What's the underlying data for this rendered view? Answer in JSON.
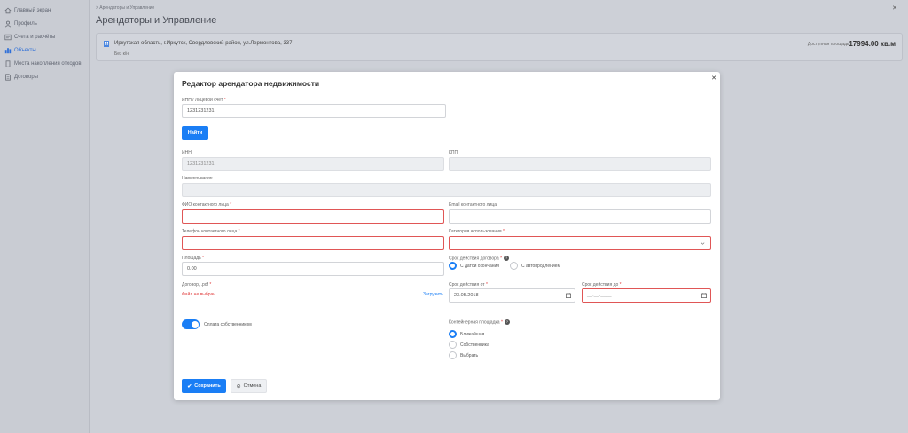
{
  "sidebar": {
    "items": [
      {
        "label": "Главный экран",
        "icon": "home-icon",
        "active": false
      },
      {
        "label": "Профиль",
        "icon": "user-icon",
        "active": false
      },
      {
        "label": "Счета и расчёты",
        "icon": "invoice-icon",
        "active": false
      },
      {
        "label": "Объекты",
        "icon": "buildings-icon",
        "active": true
      },
      {
        "label": "Места накопления отходов",
        "icon": "waste-site-icon",
        "active": false
      },
      {
        "label": "Договоры",
        "icon": "document-icon",
        "active": false
      }
    ]
  },
  "header": {
    "breadcrumb": "> Арендаторы и Управление",
    "title": "Арендаторы и Управление",
    "close": "✕"
  },
  "info_card": {
    "address": "Иркутская область, г.Иркутск, Свердловский район, ул.Лермонтова, 337",
    "sub": "Без к/н",
    "area_label": "Доступная площадь:",
    "area_value": "17994.00 кв.м"
  },
  "modal": {
    "title": "Редактор арендатора недвижимости",
    "close": "✕",
    "inn_search": {
      "label": "ИНН / Лицевой счёт",
      "value": "1231231231"
    },
    "find_button": "Найти",
    "inn": {
      "label": "ИНН",
      "value": "1231231231"
    },
    "kpp": {
      "label": "КПП",
      "value": ""
    },
    "name": {
      "label": "Наименование",
      "value": ""
    },
    "contact_name": {
      "label": "ФИО контактного лица",
      "value": ""
    },
    "contact_email": {
      "label": "Email контактного лица",
      "value": ""
    },
    "contact_phone": {
      "label": "Телефон контактного лица",
      "value": ""
    },
    "usage_category": {
      "label": "Категория использования",
      "value": ""
    },
    "area": {
      "label": "Площадь",
      "value": "0.00"
    },
    "contract_term": {
      "label": "Срок действия договора",
      "options": [
        {
          "label": "С датой окончания",
          "checked": true
        },
        {
          "label": "С автопродлением",
          "checked": false
        }
      ]
    },
    "contract_file": {
      "label": "Договор, .pdf",
      "status": "Файл не выбран",
      "upload": "Загрузить"
    },
    "valid_from": {
      "label": "Срок действия от",
      "value": "23.05.2018"
    },
    "valid_to": {
      "label": "Срок действия до",
      "value": "__.__.____"
    },
    "owner_payment": {
      "label": "Оплата собственником",
      "on": true
    },
    "container_site": {
      "label": "Контейнерная площадка",
      "options": [
        {
          "label": "Ближайшая",
          "checked": true
        },
        {
          "label": "Собственника",
          "checked": false
        },
        {
          "label": "Выбрать",
          "checked": false
        }
      ]
    },
    "save_button": "Сохранить",
    "cancel_button": "Отмена"
  },
  "colors": {
    "accent": "#1a7ef5",
    "error": "#e05656"
  }
}
